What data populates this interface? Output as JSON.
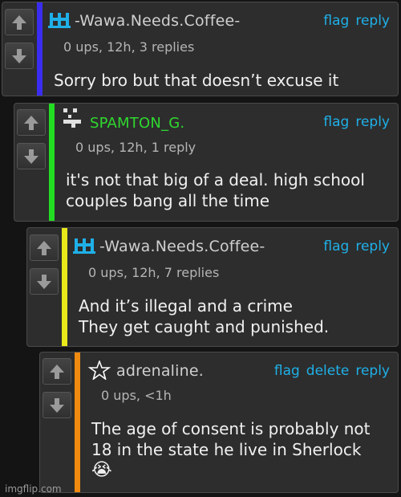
{
  "comments": [
    {
      "username": "-Wawa.Needs.Coffee-",
      "username_color": "#cfcfcf",
      "bar_color": "#3a2df0",
      "avatar_icon": "castle-glyph-icon",
      "avatar_color": "#1fb0e8",
      "meta": "0 ups, 12h, 3 replies",
      "actions": [
        "flag",
        "reply"
      ],
      "body_lines": [
        "Sorry bro but that doesn’t excuse it"
      ]
    },
    {
      "username": "SPAMTON_G.",
      "username_color": "#2fd82f",
      "bar_color": "#22dd22",
      "avatar_icon": "pixel-face-icon",
      "avatar_color": "#e0e0e0",
      "meta": "0 ups, 12h, 1 reply",
      "actions": [
        "flag",
        "reply"
      ],
      "body_lines": [
        "it's not that big of a deal. high school",
        "couples bang all the time"
      ]
    },
    {
      "username": "-Wawa.Needs.Coffee-",
      "username_color": "#cfcfcf",
      "bar_color": "#e8e81a",
      "avatar_icon": "castle-glyph-icon",
      "avatar_color": "#1fb0e8",
      "meta": "0 ups, 12h, 7 replies",
      "actions": [
        "flag",
        "reply"
      ],
      "body_lines": [
        "And it’s illegal and a crime",
        "They get caught and punished."
      ]
    },
    {
      "username": "adrenaline.",
      "username_color": "#cfcfcf",
      "bar_color": "#f08a10",
      "avatar_icon": "star-icon",
      "avatar_color": "#ffffff",
      "meta": "0 ups, <1h",
      "actions": [
        "flag",
        "delete",
        "reply"
      ],
      "body_lines": [
        "The age of consent is probably not",
        "18 in the state he live in Sherlock"
      ],
      "emoji": "😭"
    }
  ],
  "watermark": "imgflip.com"
}
